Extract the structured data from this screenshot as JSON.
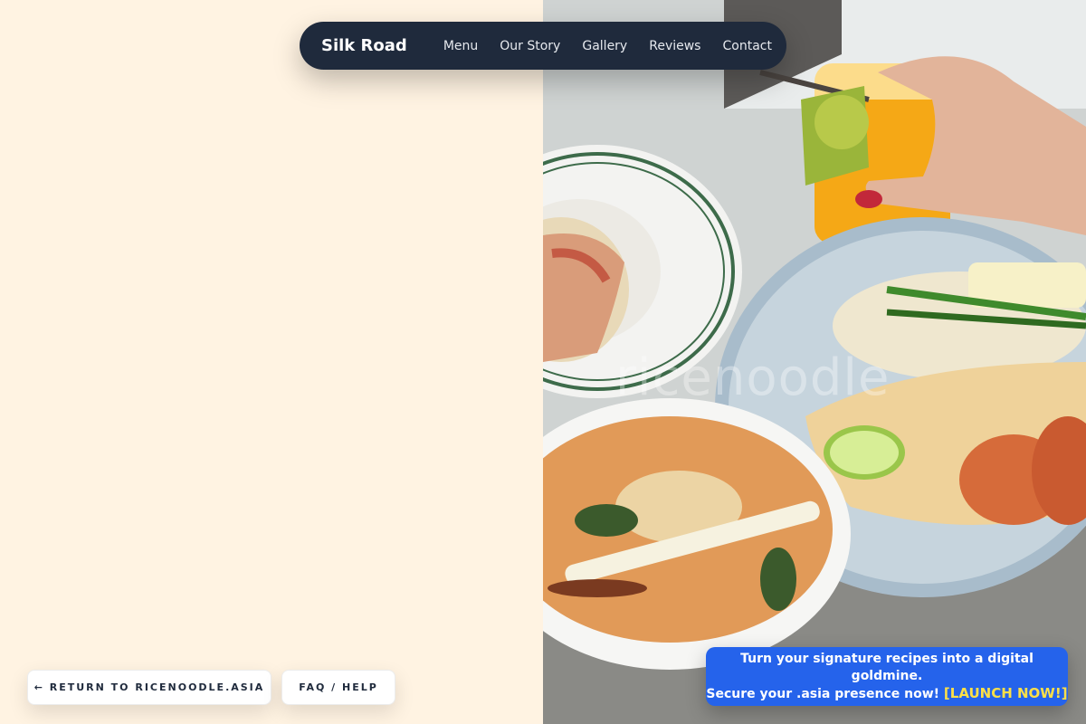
{
  "navbar": {
    "brand": "Silk Road",
    "links": [
      "Menu",
      "Our Story",
      "Gallery",
      "Reviews",
      "Contact"
    ]
  },
  "hero": {
    "watermark": "ricenoodle"
  },
  "buttons": {
    "return_label": "← RETURN TO RICENOODLE.ASIA",
    "faq_label": "FAQ / HELP"
  },
  "promo": {
    "line1": "Turn your signature recipes into a digital goldmine.",
    "line2": "Secure your .asia presence now!",
    "cta": "[LAUNCH NOW!]"
  },
  "colors": {
    "background": "#fff3e2",
    "navbar": "#1f2a3c",
    "promo": "#2563eb",
    "cta": "#fde047"
  },
  "icons": [
    "arrow-left-icon"
  ]
}
